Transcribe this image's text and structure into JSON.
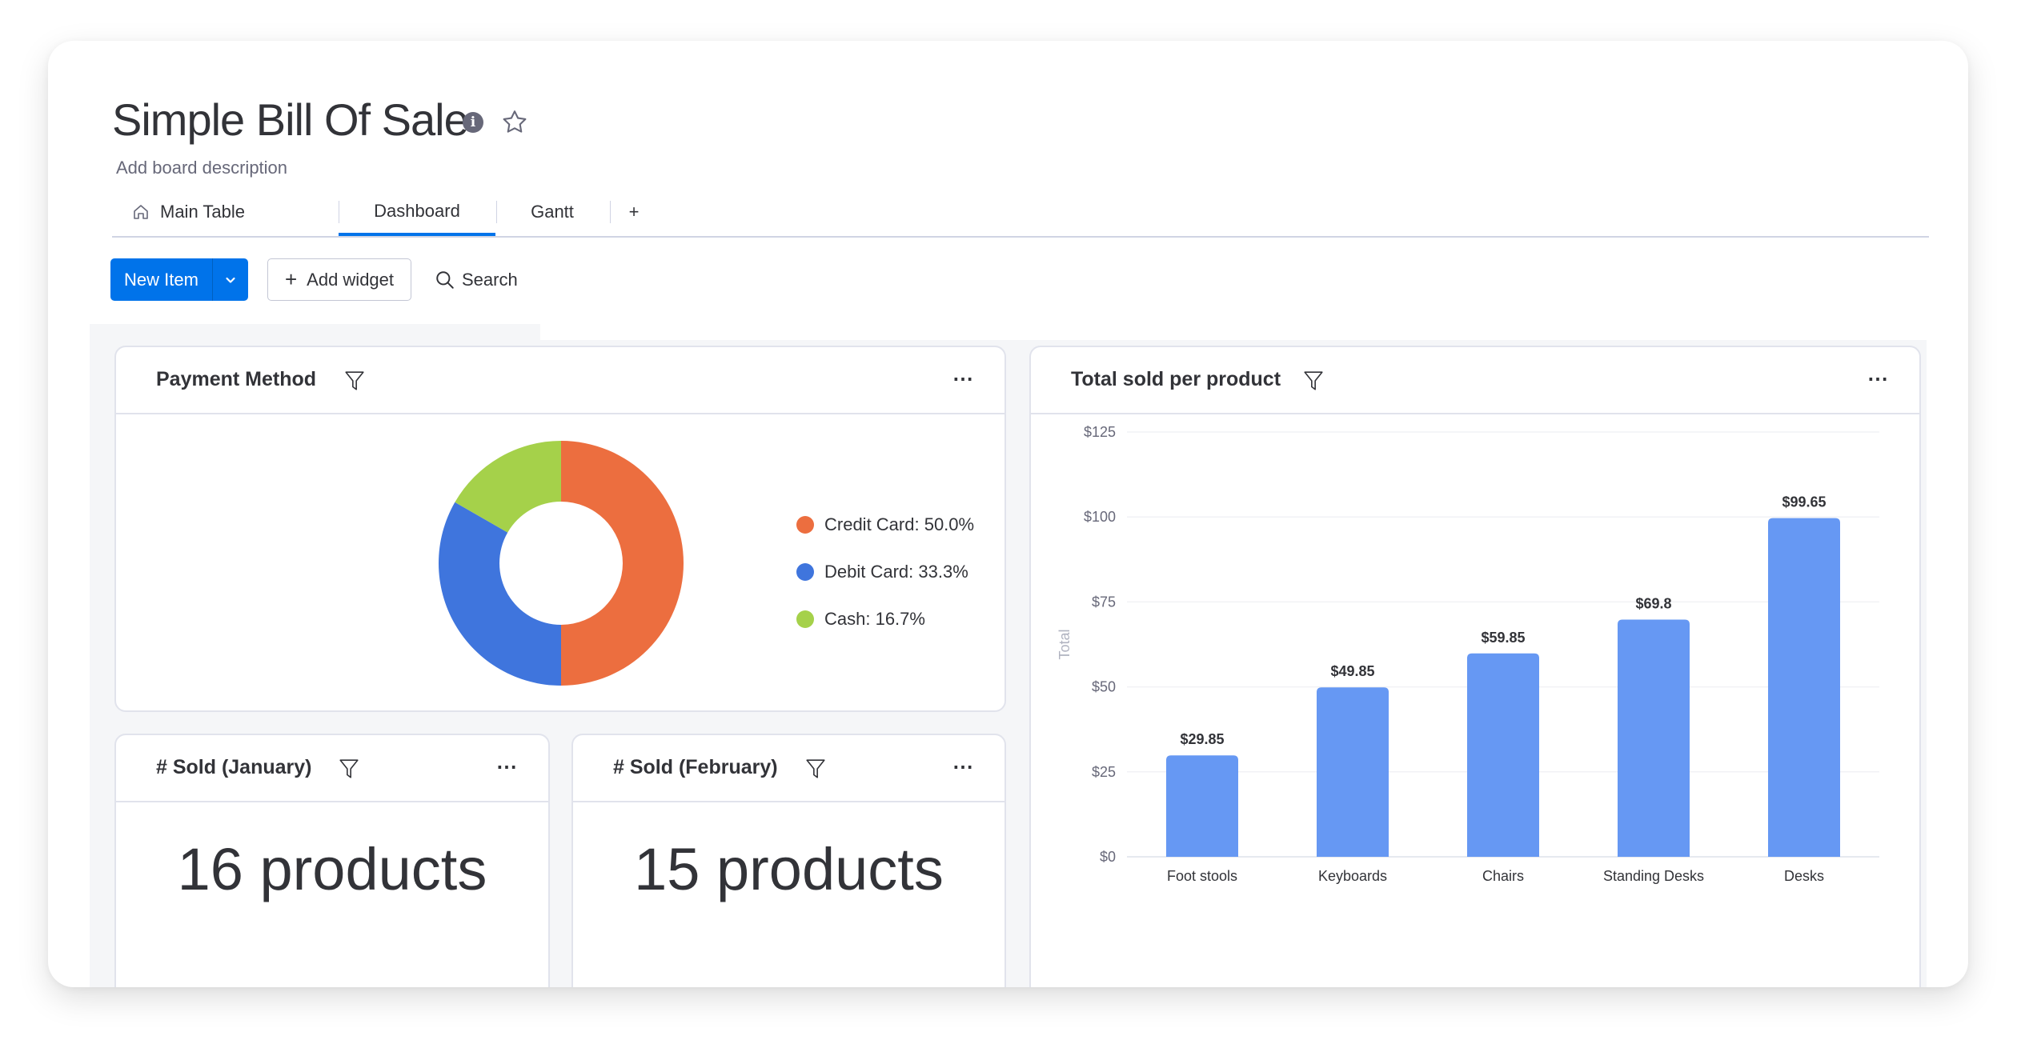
{
  "board": {
    "title": "Simple Bill Of Sale",
    "description_placeholder": "Add board description",
    "info_icon": "info-icon",
    "favorite_icon": "star-icon"
  },
  "tabs": [
    {
      "label": "Main Table",
      "icon": "home-icon",
      "active": false
    },
    {
      "label": "Dashboard",
      "active": true
    },
    {
      "label": "Gantt",
      "active": false
    },
    {
      "label": "+",
      "active": false
    }
  ],
  "toolbar": {
    "new_item_label": "New Item",
    "add_widget_label": "Add widget",
    "search_label": "Search"
  },
  "colors": {
    "primary": "#0073ea",
    "credit_card": "#ec6e3f",
    "debit_card": "#3f75dd",
    "cash": "#a5d14a",
    "bar": "#6698f3"
  },
  "widgets": {
    "payment_method": {
      "title": "Payment Method",
      "legend": [
        {
          "label": "Credit Card: 50.0%"
        },
        {
          "label": "Debit Card: 33.3%"
        },
        {
          "label": "Cash: 16.7%"
        }
      ]
    },
    "total_sold": {
      "title": "Total sold per product"
    },
    "sold_january": {
      "title": "# Sold (January)",
      "value": "16 products"
    },
    "sold_february": {
      "title": "# Sold (February)",
      "value": "15 products"
    }
  },
  "chart_data": [
    {
      "type": "pie",
      "title": "Payment Method",
      "categories": [
        "Credit Card",
        "Debit Card",
        "Cash"
      ],
      "values": [
        50.0,
        33.3,
        16.7
      ],
      "colors": [
        "#ec6e3f",
        "#3f75dd",
        "#a5d14a"
      ],
      "donut": true,
      "legend": "right"
    },
    {
      "type": "bar",
      "title": "Total sold per product",
      "categories": [
        "Foot stools",
        "Keyboards",
        "Chairs",
        "Standing Desks",
        "Desks"
      ],
      "values": [
        29.85,
        49.85,
        59.85,
        69.8,
        99.65
      ],
      "value_labels": [
        "$29.85",
        "$49.85",
        "$59.85",
        "$69.8",
        "$99.65"
      ],
      "xlabel": "",
      "ylabel": "Total",
      "ylim": [
        0,
        125
      ],
      "yticks": [
        0,
        25,
        50,
        75,
        100,
        125
      ],
      "ytick_labels": [
        "$0",
        "$25",
        "$50",
        "$75",
        "$100",
        "$125"
      ],
      "grid": true,
      "color": "#6698f3"
    }
  ]
}
